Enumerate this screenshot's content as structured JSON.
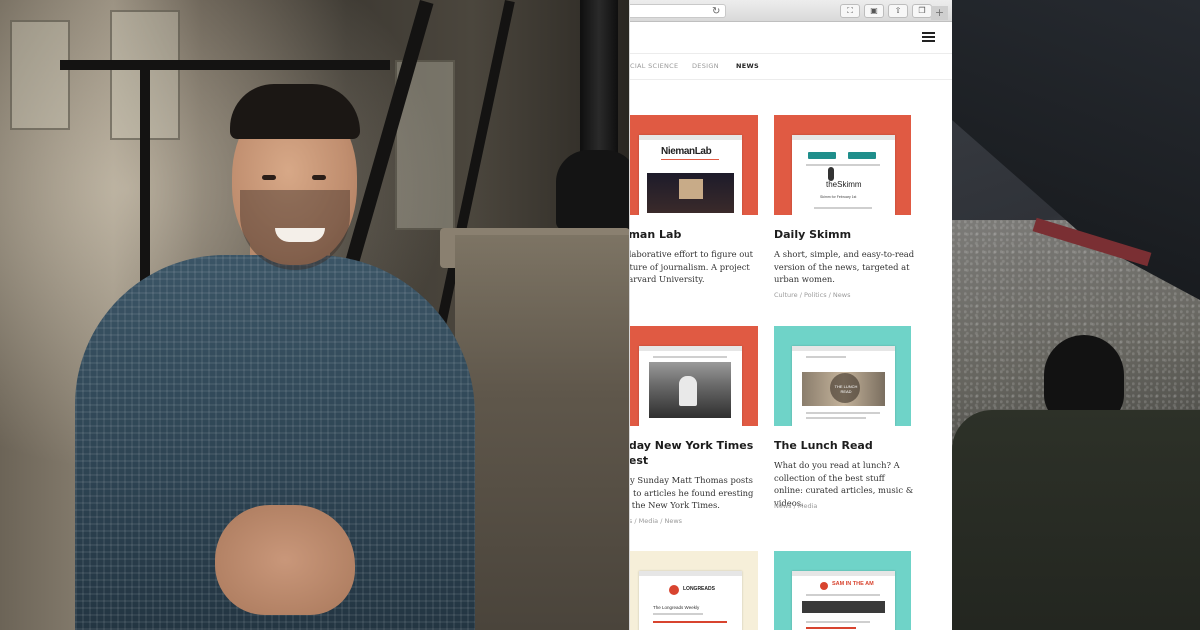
{
  "browser": {
    "reload_icon": "reload-icon",
    "toolbar_buttons": [
      "reader-icon",
      "extension-icon",
      "share-icon",
      "tabs-icon"
    ],
    "new_tab_label": "+"
  },
  "nav": {
    "tabs": [
      {
        "label": "CIAL SCIENCE",
        "active": false
      },
      {
        "label": "DESIGN",
        "active": false
      },
      {
        "label": "NEWS",
        "active": true
      }
    ]
  },
  "cards": [
    {
      "title": "eman Lab",
      "description": "ollaborative effort to figure out future of journalism. A project Harvard University.",
      "tags": "s",
      "thumb_color": "#e05a43",
      "thumb_logo": "NiemanLab"
    },
    {
      "title": "Daily Skimm",
      "description": "A short, simple, and easy-to-read version of the news, targeted at urban women.",
      "tags": "Culture / Politics / News",
      "thumb_color": "#e05a43",
      "thumb_logo": "theSkimm"
    },
    {
      "title": "nday New York Times gest",
      "description": "ery Sunday Matt Thomas posts ks to articles he found eresting in the New York Times.",
      "tags": "tics / Media / News",
      "thumb_color": "#e05a43",
      "thumb_logo": ""
    },
    {
      "title": "The Lunch Read",
      "description": "What do you read at lunch? A collection of the best stuff online: curated articles, music & videos.",
      "tags": "News / Media",
      "thumb_color": "#6fd3c8",
      "thumb_logo": "THE LUNCH READ"
    },
    {
      "title": "",
      "description": "",
      "tags": "",
      "thumb_color": "#f6efd9",
      "thumb_logo": "LONGREADS"
    },
    {
      "title": "",
      "description": "",
      "tags": "",
      "thumb_color": "#6fd3c8",
      "thumb_logo": "SAM IN THE AM"
    }
  ],
  "thumb_text": {
    "skimm_footer": "Skimm for February 1st",
    "longreads_sub": "The Longreads Weekly"
  }
}
